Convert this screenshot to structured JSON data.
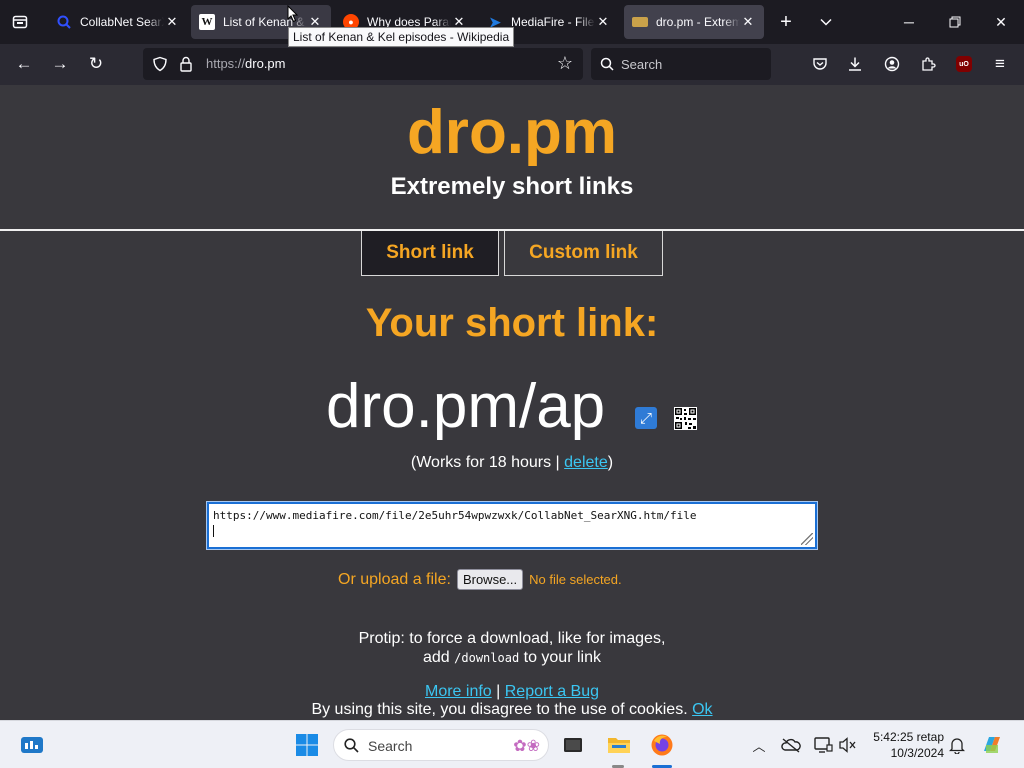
{
  "browser": {
    "tabs": [
      {
        "title": "CollabNet SearXNG",
        "icon": "searxng-favicon",
        "state": "normal"
      },
      {
        "title": "List of Kenan & Kel episodes - Wikipedia",
        "icon": "wikipedia-favicon",
        "state": "hover"
      },
      {
        "title": "Why does Paramount",
        "icon": "reddit-favicon",
        "state": "normal"
      },
      {
        "title": "MediaFire - File sharing",
        "icon": "mediafire-favicon",
        "state": "normal"
      },
      {
        "title": "dro.pm - Extremely short links",
        "icon": "dropm-favicon",
        "state": "active"
      }
    ],
    "tooltip": "List of Kenan & Kel episodes - Wikipedia",
    "url_scheme": "https://",
    "url_host": "dro.pm",
    "search_placeholder": "Search"
  },
  "page": {
    "logo": "dro.pm",
    "tagline": "Extremely short links",
    "modes": {
      "short": "Short link",
      "custom": "Custom link"
    },
    "result_heading": "Your short link:",
    "short_link": "dro.pm/ap",
    "works_prefix": "(Works for 18 hours | ",
    "delete_label": "delete",
    "works_suffix": ")",
    "long_url": "https://www.mediafire.com/file/2e5uhr54wpwzwxk/CollabNet_SearXNG.htm/file",
    "upload_label": "Or upload a file:",
    "browse_label": "Browse...",
    "no_file": "No file selected.",
    "protip_line1": "Protip: to force a download, like for images,",
    "protip_add": "add ",
    "protip_code": "/download",
    "protip_end": " to your link",
    "more_info": "More info",
    "separator": " | ",
    "report_bug": "Report a Bug",
    "cookie_text": "By using this site, you disagree to the use of cookies. ",
    "cookie_ok": "Ok"
  },
  "taskbar": {
    "search_placeholder": "Search",
    "time": "5:42:25 retap",
    "date": "10/3/2024"
  },
  "colors": {
    "accent": "#f5a623",
    "link": "#3bc6f2",
    "page_bg": "#39383d"
  }
}
